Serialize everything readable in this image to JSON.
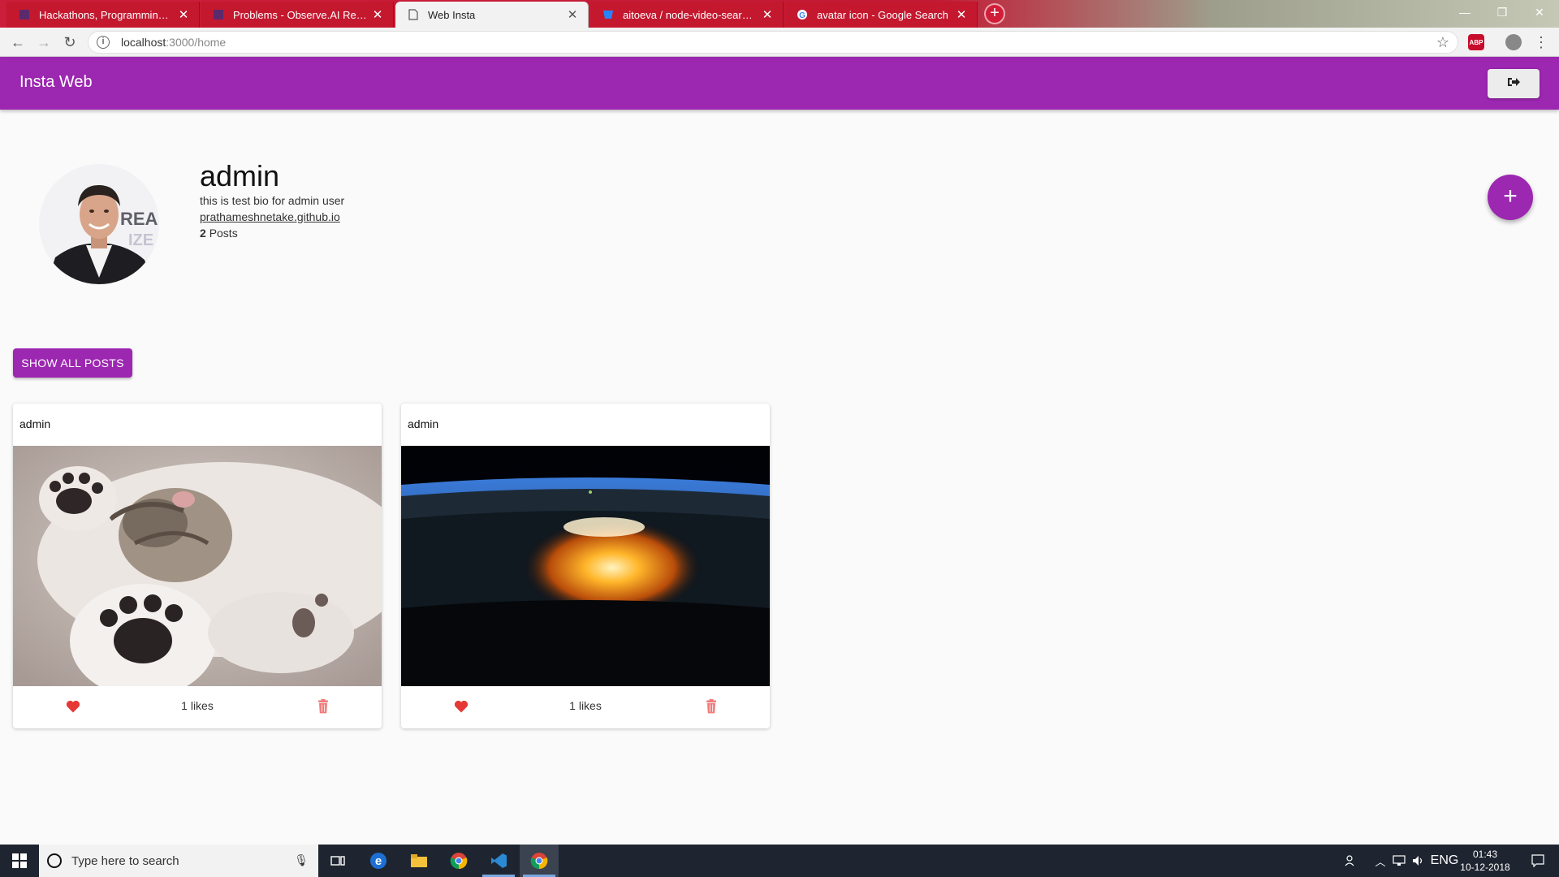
{
  "browser": {
    "tabs": [
      {
        "title": "Hackathons, Programming & Co",
        "active": false
      },
      {
        "title": "Problems - Observe.AI ReactJs H",
        "active": false
      },
      {
        "title": "Web Insta",
        "active": true
      },
      {
        "title": "aitoeva / node-video-search / ba",
        "active": false
      },
      {
        "title": "avatar icon - Google Search",
        "active": false
      }
    ],
    "url_host": "localhost",
    "url_rest": ":3000/home",
    "extension_label": "ABP"
  },
  "app": {
    "title": "Insta Web",
    "accent_color": "#9c27b0"
  },
  "profile": {
    "username": "admin",
    "bio": "this is test bio for admin user",
    "website": "prathameshnetake.github.io",
    "posts_count": "2",
    "posts_label": "Posts"
  },
  "actions": {
    "show_all_label": "SHOW ALL POSTS",
    "add_label": "+"
  },
  "posts": [
    {
      "author": "admin",
      "image": "kitten-photo",
      "likes_text": "1 likes"
    },
    {
      "author": "admin",
      "image": "earth-from-space-photo",
      "likes_text": "1 likes"
    }
  ],
  "taskbar": {
    "search_placeholder": "Type here to search",
    "lang": "ENG",
    "time": "01:43",
    "date": "10-12-2018"
  }
}
